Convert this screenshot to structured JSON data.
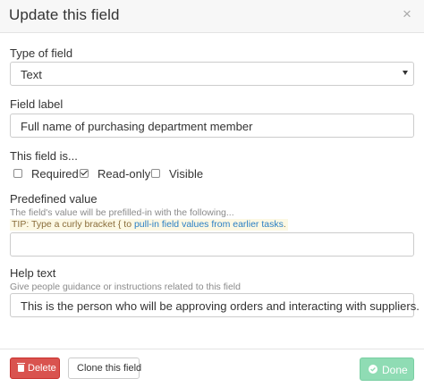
{
  "dialog": {
    "title": "Update this field"
  },
  "type_of_field": {
    "label": "Type of field",
    "value": "Text"
  },
  "field_label": {
    "label": "Field label",
    "value": "Full name of purchasing department member"
  },
  "this_field_is": {
    "label": "This field is...",
    "options": [
      {
        "label": "Required",
        "checked": false
      },
      {
        "label": "Read-only",
        "checked": true
      },
      {
        "label": "Visible",
        "checked": false
      }
    ]
  },
  "predefined_value": {
    "label": "Predefined value",
    "help": "The field's value will be prefilled-in with the following...",
    "tip_prefix": "TIP: Type a curly bracket { to ",
    "tip_link": "pull-in field values from earlier tasks",
    "tip_suffix": ".",
    "value": ""
  },
  "help_text": {
    "label": "Help text",
    "help": "Give people guidance or instructions related to this field",
    "value": "This is the person who will be approving orders and interacting with suppliers."
  },
  "footer": {
    "delete_label": "Delete",
    "clone_label": "Clone this field",
    "done_label": "Done"
  },
  "colors": {
    "delete": "#d9534f",
    "done": "#8fdcb4",
    "link": "#2a7fc4",
    "tip_background": "#fcf8e3"
  },
  "icons": {
    "close": "close-icon",
    "select_caret": "caret-down-icon",
    "delete": "trash-icon",
    "done": "check-circle-icon"
  }
}
